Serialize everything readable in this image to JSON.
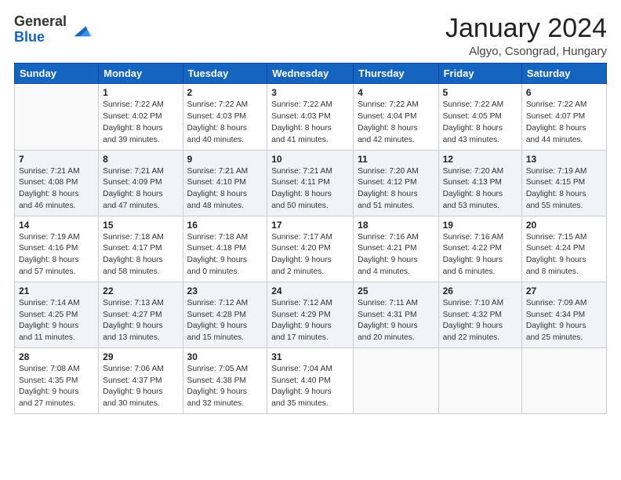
{
  "logo": {
    "general": "General",
    "blue": "Blue"
  },
  "header": {
    "month_year": "January 2024",
    "location": "Algyo, Csongrad, Hungary"
  },
  "weekdays": [
    "Sunday",
    "Monday",
    "Tuesday",
    "Wednesday",
    "Thursday",
    "Friday",
    "Saturday"
  ],
  "weeks": [
    [
      {
        "day": "",
        "info": ""
      },
      {
        "day": "1",
        "info": "Sunrise: 7:22 AM\nSunset: 4:02 PM\nDaylight: 8 hours\nand 39 minutes."
      },
      {
        "day": "2",
        "info": "Sunrise: 7:22 AM\nSunset: 4:03 PM\nDaylight: 8 hours\nand 40 minutes."
      },
      {
        "day": "3",
        "info": "Sunrise: 7:22 AM\nSunset: 4:03 PM\nDaylight: 8 hours\nand 41 minutes."
      },
      {
        "day": "4",
        "info": "Sunrise: 7:22 AM\nSunset: 4:04 PM\nDaylight: 8 hours\nand 42 minutes."
      },
      {
        "day": "5",
        "info": "Sunrise: 7:22 AM\nSunset: 4:05 PM\nDaylight: 8 hours\nand 43 minutes."
      },
      {
        "day": "6",
        "info": "Sunrise: 7:22 AM\nSunset: 4:07 PM\nDaylight: 8 hours\nand 44 minutes."
      }
    ],
    [
      {
        "day": "7",
        "info": "Sunrise: 7:21 AM\nSunset: 4:08 PM\nDaylight: 8 hours\nand 46 minutes."
      },
      {
        "day": "8",
        "info": "Sunrise: 7:21 AM\nSunset: 4:09 PM\nDaylight: 8 hours\nand 47 minutes."
      },
      {
        "day": "9",
        "info": "Sunrise: 7:21 AM\nSunset: 4:10 PM\nDaylight: 8 hours\nand 48 minutes."
      },
      {
        "day": "10",
        "info": "Sunrise: 7:21 AM\nSunset: 4:11 PM\nDaylight: 8 hours\nand 50 minutes."
      },
      {
        "day": "11",
        "info": "Sunrise: 7:20 AM\nSunset: 4:12 PM\nDaylight: 8 hours\nand 51 minutes."
      },
      {
        "day": "12",
        "info": "Sunrise: 7:20 AM\nSunset: 4:13 PM\nDaylight: 8 hours\nand 53 minutes."
      },
      {
        "day": "13",
        "info": "Sunrise: 7:19 AM\nSunset: 4:15 PM\nDaylight: 8 hours\nand 55 minutes."
      }
    ],
    [
      {
        "day": "14",
        "info": "Sunrise: 7:19 AM\nSunset: 4:16 PM\nDaylight: 8 hours\nand 57 minutes."
      },
      {
        "day": "15",
        "info": "Sunrise: 7:18 AM\nSunset: 4:17 PM\nDaylight: 8 hours\nand 58 minutes."
      },
      {
        "day": "16",
        "info": "Sunrise: 7:18 AM\nSunset: 4:18 PM\nDaylight: 9 hours\nand 0 minutes."
      },
      {
        "day": "17",
        "info": "Sunrise: 7:17 AM\nSunset: 4:20 PM\nDaylight: 9 hours\nand 2 minutes."
      },
      {
        "day": "18",
        "info": "Sunrise: 7:16 AM\nSunset: 4:21 PM\nDaylight: 9 hours\nand 4 minutes."
      },
      {
        "day": "19",
        "info": "Sunrise: 7:16 AM\nSunset: 4:22 PM\nDaylight: 9 hours\nand 6 minutes."
      },
      {
        "day": "20",
        "info": "Sunrise: 7:15 AM\nSunset: 4:24 PM\nDaylight: 9 hours\nand 8 minutes."
      }
    ],
    [
      {
        "day": "21",
        "info": "Sunrise: 7:14 AM\nSunset: 4:25 PM\nDaylight: 9 hours\nand 11 minutes."
      },
      {
        "day": "22",
        "info": "Sunrise: 7:13 AM\nSunset: 4:27 PM\nDaylight: 9 hours\nand 13 minutes."
      },
      {
        "day": "23",
        "info": "Sunrise: 7:12 AM\nSunset: 4:28 PM\nDaylight: 9 hours\nand 15 minutes."
      },
      {
        "day": "24",
        "info": "Sunrise: 7:12 AM\nSunset: 4:29 PM\nDaylight: 9 hours\nand 17 minutes."
      },
      {
        "day": "25",
        "info": "Sunrise: 7:11 AM\nSunset: 4:31 PM\nDaylight: 9 hours\nand 20 minutes."
      },
      {
        "day": "26",
        "info": "Sunrise: 7:10 AM\nSunset: 4:32 PM\nDaylight: 9 hours\nand 22 minutes."
      },
      {
        "day": "27",
        "info": "Sunrise: 7:09 AM\nSunset: 4:34 PM\nDaylight: 9 hours\nand 25 minutes."
      }
    ],
    [
      {
        "day": "28",
        "info": "Sunrise: 7:08 AM\nSunset: 4:35 PM\nDaylight: 9 hours\nand 27 minutes."
      },
      {
        "day": "29",
        "info": "Sunrise: 7:06 AM\nSunset: 4:37 PM\nDaylight: 9 hours\nand 30 minutes."
      },
      {
        "day": "30",
        "info": "Sunrise: 7:05 AM\nSunset: 4:38 PM\nDaylight: 9 hours\nand 32 minutes."
      },
      {
        "day": "31",
        "info": "Sunrise: 7:04 AM\nSunset: 4:40 PM\nDaylight: 9 hours\nand 35 minutes."
      },
      {
        "day": "",
        "info": ""
      },
      {
        "day": "",
        "info": ""
      },
      {
        "day": "",
        "info": ""
      }
    ]
  ]
}
